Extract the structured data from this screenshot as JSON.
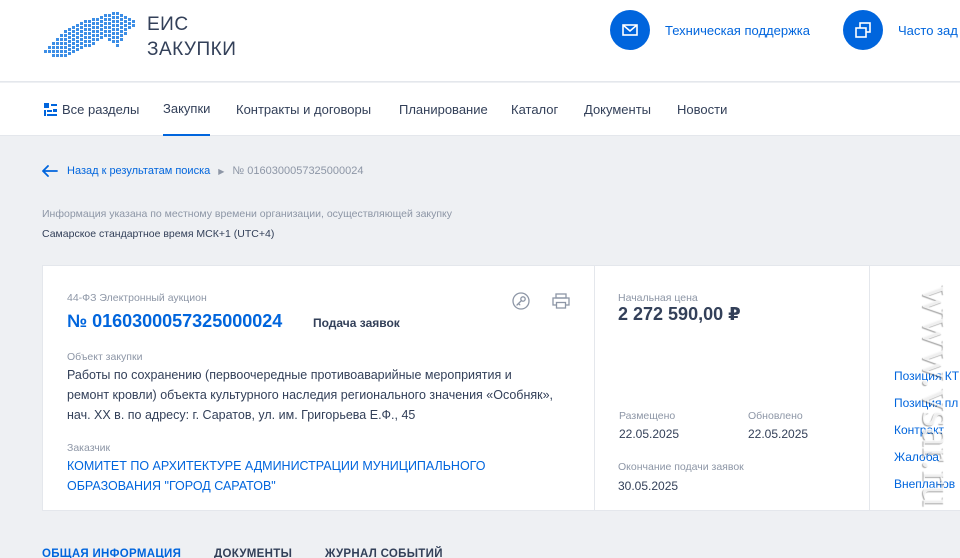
{
  "header": {
    "logo_line1": "ЕИС",
    "logo_line2": "ЗАКУПКИ",
    "support_label": "Техническая поддержка",
    "faq_label": "Часто зад"
  },
  "nav": {
    "items": [
      "Все разделы",
      "Закупки",
      "Контракты и договоры",
      "Планирование",
      "Каталог",
      "Документы",
      "Новости"
    ],
    "active_index": 1
  },
  "breadcrumb": {
    "back_label": "Назад к результатам поиска",
    "current": "№ 0160300057325000024"
  },
  "timezone": {
    "note": "Информация указана по местному времени организации, осуществляющей закупку",
    "value": "Самарское стандартное время МСК+1 (UTC+4)"
  },
  "card": {
    "law": "44-ФЗ Электронный аукцион",
    "number": "№ 0160300057325000024",
    "stage": "Подача заявок",
    "object_label": "Объект закупки",
    "object_text": "Работы по сохранению (первоочередные противоаварийные мероприятия и ремонт кровли) объекта культурного наследия регионального значения «Особняк», нач. XX в. по адресу: г. Саратов, ул. им. Григорьева Е.Ф., 45",
    "customer_label": "Заказчик",
    "customer_name": "КОМИТЕТ ПО АРХИТЕКТУРЕ АДМИНИСТРАЦИИ МУНИЦИПАЛЬНОГО ОБРАЗОВАНИЯ \"ГОРОД САРАТОВ\"",
    "price_label": "Начальная цена",
    "price": "2 272 590,00 ₽",
    "placed_label": "Размещено",
    "placed_date": "22.05.2025",
    "updated_label": "Обновлено",
    "updated_date": "22.05.2025",
    "deadline_label": "Окончание подачи заявок",
    "deadline_date": "30.05.2025"
  },
  "side_links": [
    "Позиция КТ",
    "Позиция пл",
    "Контракт",
    "Жалоба",
    "Внепланов"
  ],
  "tabs": [
    "ОБЩАЯ ИНФОРМАЦИЯ",
    "ДОКУМЕНТЫ",
    "ЖУРНАЛ СОБЫТИЙ"
  ],
  "watermark": "www.vsar.ru",
  "colors": {
    "accent": "#0065dd",
    "text": "#334059",
    "muted": "#8d96a6",
    "background": "#eef0f3"
  },
  "icons": [
    "russia-map-logo",
    "envelope-icon",
    "windows-icon",
    "sections-icon",
    "back-arrow-icon",
    "key-icon",
    "print-icon"
  ]
}
